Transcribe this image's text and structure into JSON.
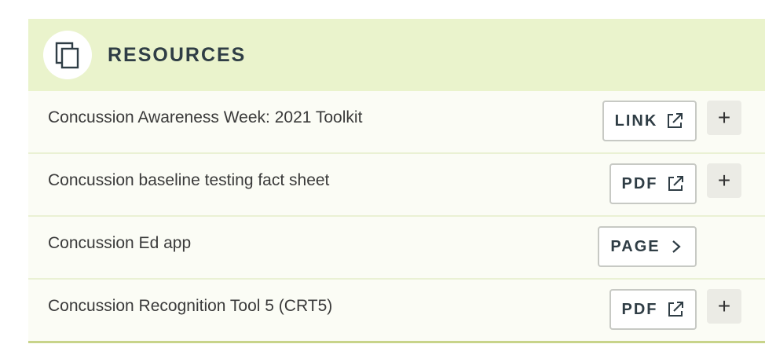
{
  "section": {
    "title": "RESOURCES",
    "icon": "documents-icon"
  },
  "resources": [
    {
      "title": "Concussion Awareness Week: 2021 Toolkit",
      "type_label": "LINK",
      "type_icon": "external-link-icon",
      "expand_label": "+"
    },
    {
      "title": "Concussion baseline testing fact sheet",
      "type_label": "PDF",
      "type_icon": "external-link-icon",
      "expand_label": "+"
    },
    {
      "title": "Concussion Ed app",
      "type_label": "PAGE",
      "type_icon": "chevron-right-icon"
    },
    {
      "title": "Concussion Recognition Tool 5 (CRT5)",
      "type_label": "PDF",
      "type_icon": "external-link-icon",
      "expand_label": "+"
    }
  ],
  "colors": {
    "header_bg": "#eaf3cc",
    "row_bg": "#fbfcf5",
    "text": "#2f3d45"
  }
}
